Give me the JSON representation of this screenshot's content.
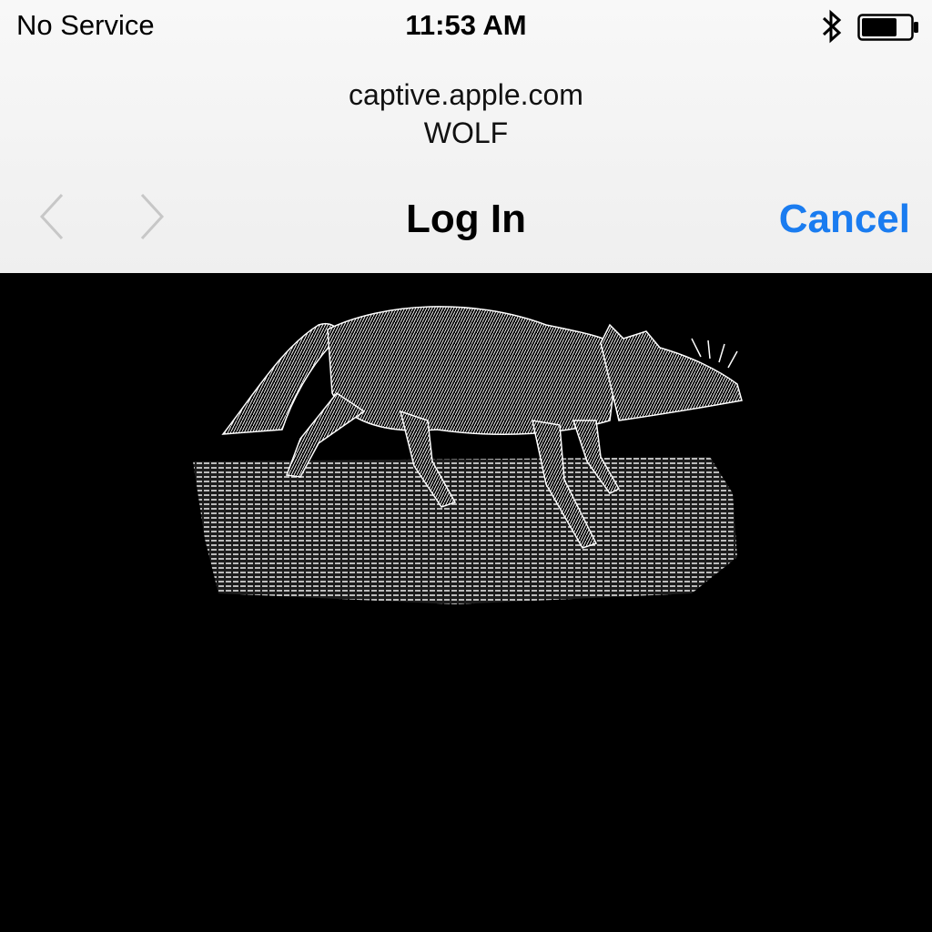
{
  "status_bar": {
    "carrier": "No Service",
    "time": "11:53 AM",
    "icons": [
      "bluetooth-icon",
      "battery-icon"
    ],
    "battery_level": 0.75
  },
  "page_header": {
    "domain": "captive.apple.com",
    "network_name": "WOLF"
  },
  "nav_bar": {
    "title": "Log In",
    "cancel_label": "Cancel",
    "back_icon": "chevron-left-icon",
    "forward_icon": "chevron-right-icon"
  },
  "content": {
    "image": "wolf-illustration"
  },
  "colors": {
    "accent": "#1a7cf0",
    "header_bg": "#f4f4f4",
    "content_bg": "#000000",
    "disabled_chevron": "#c7c7c7"
  }
}
